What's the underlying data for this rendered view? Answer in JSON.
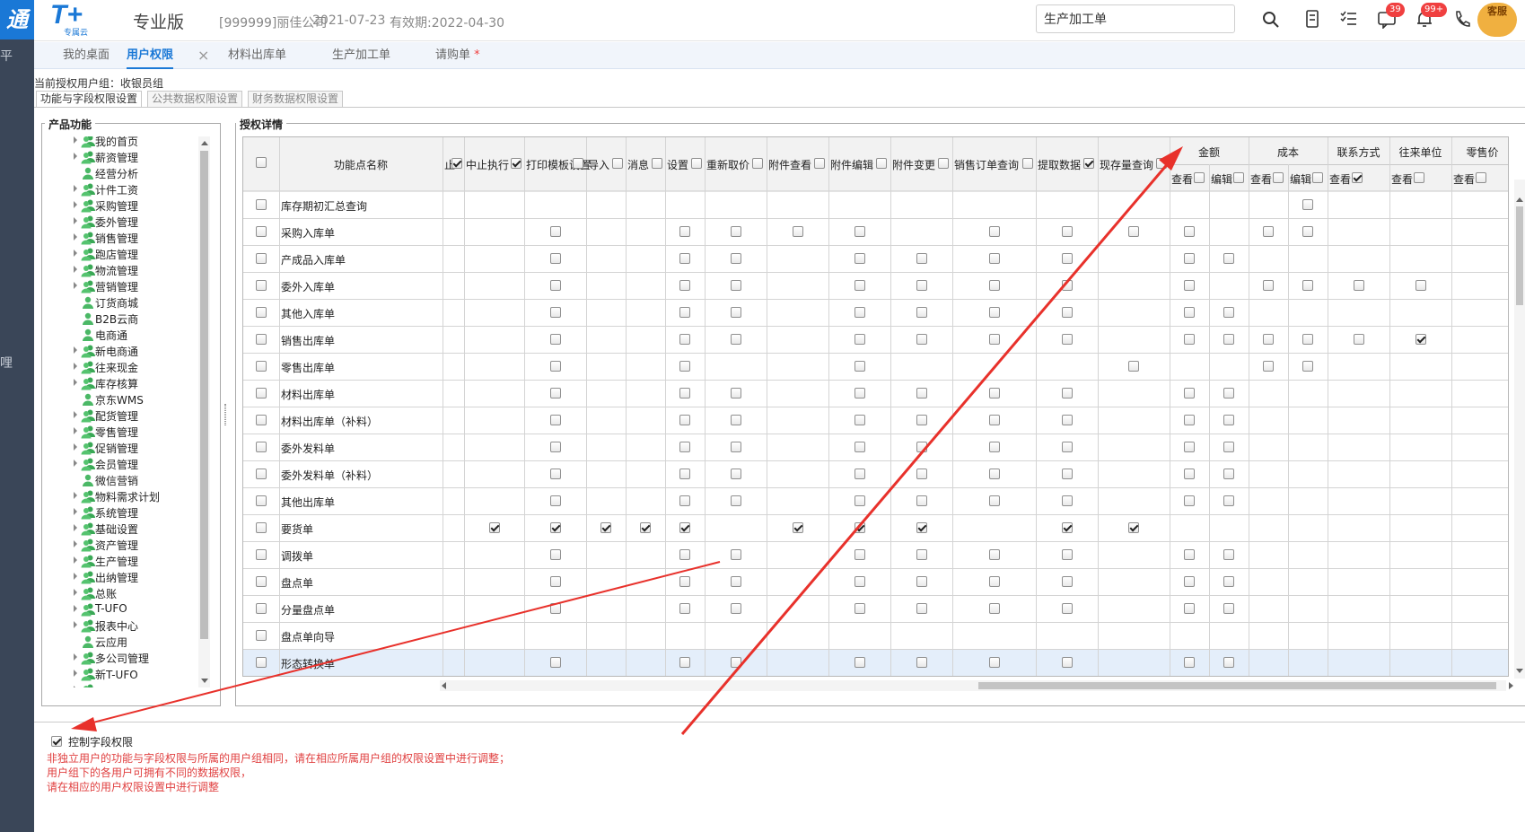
{
  "app": {
    "brand_text": "通",
    "logo_text": "T+",
    "logo_sub": "专属云",
    "edition": "专业版",
    "company": "[999999]丽佳公司",
    "date": "2021-07-23",
    "valid_until": "有效期:2022-04-30",
    "search_value": "生产加工单",
    "badge_messages": "39",
    "badge_notices": "99+",
    "avatar_label": "客服",
    "accent": "#1a78d6"
  },
  "leftbar": {
    "glyph1": "平",
    "glyph2": "哩"
  },
  "tabs": [
    {
      "label": "我的桌面"
    },
    {
      "label": "用户权限",
      "active": true,
      "close": "×"
    },
    {
      "label": "材料出库单"
    },
    {
      "label": "生产加工单"
    },
    {
      "label": "请购单",
      "required_mark": "*"
    }
  ],
  "group": {
    "label": "当前授权用户组：",
    "value": "收银员组"
  },
  "subtabs": [
    {
      "label": "功能与字段权限设置"
    },
    {
      "label": "公共数据权限设置"
    },
    {
      "label": "财务数据权限设置"
    }
  ],
  "tree": {
    "title": "产品功能",
    "items": [
      {
        "label": "我的首页",
        "expandable": true
      },
      {
        "label": "薪资管理",
        "expandable": true
      },
      {
        "label": "经营分析",
        "expandable": false
      },
      {
        "label": "计件工资",
        "expandable": true
      },
      {
        "label": "采购管理",
        "expandable": true
      },
      {
        "label": "委外管理",
        "expandable": true
      },
      {
        "label": "销售管理",
        "expandable": true
      },
      {
        "label": "跑店管理",
        "expandable": true
      },
      {
        "label": "物流管理",
        "expandable": true
      },
      {
        "label": "营销管理",
        "expandable": true
      },
      {
        "label": "订货商城",
        "expandable": false
      },
      {
        "label": "B2B云商",
        "expandable": false
      },
      {
        "label": "电商通",
        "expandable": false
      },
      {
        "label": "新电商通",
        "expandable": true
      },
      {
        "label": "往来现金",
        "expandable": true
      },
      {
        "label": "库存核算",
        "expandable": true
      },
      {
        "label": "京东WMS",
        "expandable": false
      },
      {
        "label": "配货管理",
        "expandable": true
      },
      {
        "label": "零售管理",
        "expandable": true
      },
      {
        "label": "促销管理",
        "expandable": true
      },
      {
        "label": "会员管理",
        "expandable": true
      },
      {
        "label": "微信营销",
        "expandable": false
      },
      {
        "label": "物料需求计划",
        "expandable": true
      },
      {
        "label": "系统管理",
        "expandable": true
      },
      {
        "label": "基础设置",
        "expandable": true
      },
      {
        "label": "资产管理",
        "expandable": true
      },
      {
        "label": "生产管理",
        "expandable": true
      },
      {
        "label": "出纳管理",
        "expandable": true
      },
      {
        "label": "总账",
        "expandable": true
      },
      {
        "label": "T-UFO",
        "expandable": true
      },
      {
        "label": "报表中心",
        "expandable": true
      },
      {
        "label": "云应用",
        "expandable": false
      },
      {
        "label": "多公司管理",
        "expandable": true
      },
      {
        "label": "新T-UFO",
        "expandable": true
      },
      {
        "label": "",
        "expandable": true
      }
    ]
  },
  "grid": {
    "title": "授权详情",
    "name_header": "功能点名称",
    "cut_header": "止",
    "columns": [
      {
        "label": "中止执行",
        "checked": true
      },
      {
        "label": "打印模板设置",
        "checked": false
      },
      {
        "label": "导入",
        "checked": false
      },
      {
        "label": "消息",
        "checked": false
      },
      {
        "label": "设置",
        "checked": false
      },
      {
        "label": "重新取价",
        "checked": false
      },
      {
        "label": "附件查看",
        "checked": false
      },
      {
        "label": "附件编辑",
        "checked": false
      },
      {
        "label": "附件变更",
        "checked": false
      },
      {
        "label": "销售订单查询",
        "checked": false
      },
      {
        "label": "提取数据",
        "checked": true
      },
      {
        "label": "现存量查询",
        "checked": false
      }
    ],
    "groups": [
      {
        "label": "金额",
        "subs": [
          {
            "label": "查看",
            "checked": false
          },
          {
            "label": "编辑",
            "checked": false
          }
        ]
      },
      {
        "label": "成本",
        "subs": [
          {
            "label": "查看",
            "checked": false
          },
          {
            "label": "编辑",
            "checked": false
          }
        ]
      },
      {
        "label": "联系方式",
        "subs": [
          {
            "label": "查看",
            "checked": true
          }
        ]
      },
      {
        "label": "往来单位",
        "subs": [
          {
            "label": "查看",
            "checked": false
          }
        ]
      },
      {
        "label": "零售价",
        "subs": [
          {
            "label": "查看",
            "checked": false
          }
        ]
      }
    ],
    "rows": [
      {
        "name": "库存期初汇总查询",
        "cells": "xxxxxxxxxxxxxxx.xxx",
        "selected": false
      },
      {
        "name": "采购入库单",
        "cells": "x.xx....x....x..xxx",
        "selected": false
      },
      {
        "name": "产成品入库单",
        "cells": "x.xx..x....x..xxxxx",
        "selected": false
      },
      {
        "name": "委外入库单",
        "cells": "x.xx..x....x.x....x",
        "selected": false
      },
      {
        "name": "其他入库单",
        "cells": "x.xx..x....x..xxxxx",
        "selected": false
      },
      {
        "name": "销售出库单",
        "cells": "x.xx..x....x.....2x",
        "selected": false
      },
      {
        "name": "零售出库单",
        "cells": "x.xx.xx.xxx.xx..xxx",
        "selected": false
      },
      {
        "name": "材料出库单",
        "cells": "x.xx..x....x..xxxxx",
        "selected": false
      },
      {
        "name": "材料出库单（补料）",
        "cells": "x.xx..x....x..xxxxx",
        "selected": false
      },
      {
        "name": "委外发料单",
        "cells": "x.xx..x....x..xxxxx",
        "selected": false
      },
      {
        "name": "委外发料单（补料）",
        "cells": "x.xx..x....x..xxxxx",
        "selected": false
      },
      {
        "name": "其他出库单",
        "cells": "x.xx..x....x..xxxxx",
        "selected": false
      },
      {
        "name": "要货单",
        "cells": "22222x222x22xxxxxxx",
        "selected": false
      },
      {
        "name": "调拨单",
        "cells": "x.xx..x....x..xxxxx",
        "selected": false
      },
      {
        "name": "盘点单",
        "cells": "x.xx..x....x..xxxxx",
        "selected": false
      },
      {
        "name": "分量盘点单",
        "cells": "x.xx..x....x..xxxxx",
        "selected": false
      },
      {
        "name": "盘点单向导",
        "cells": "xxxxxxxxxxxxxxxxxxx",
        "selected": false
      },
      {
        "name": "形态转换单",
        "cells": "x.xx..x....x..xxxxx",
        "selected": true
      }
    ]
  },
  "footer": {
    "control_label": "控制字段权限",
    "control_checked": true,
    "notes": [
      "非独立用户的功能与字段权限与所属的用户组相同，请在相应所属用户组的权限设置中进行调整；",
      "用户组下的各用户可拥有不同的数据权限，",
      "请在相应的用户权限设置中进行调整"
    ]
  },
  "annotation_color": "#e8312b"
}
